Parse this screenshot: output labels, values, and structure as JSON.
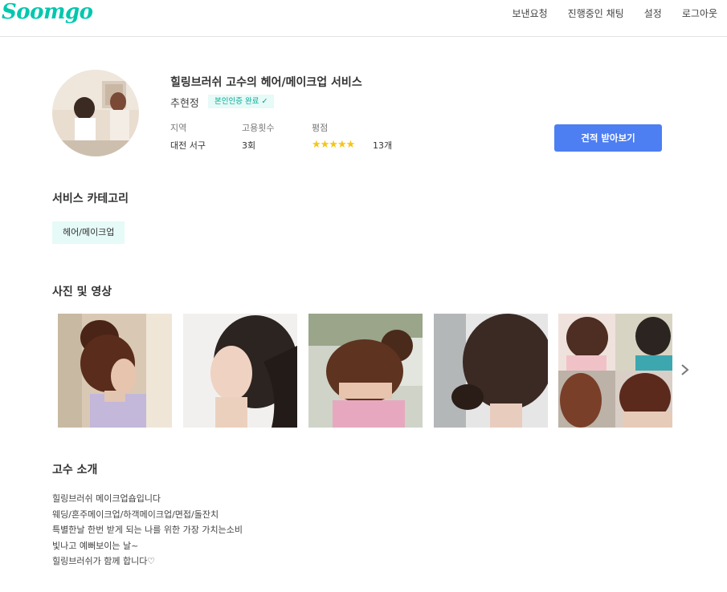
{
  "header": {
    "logo": "Soomgo",
    "nav": [
      "보낸요청",
      "진행중인 채팅",
      "설정",
      "로그아웃"
    ]
  },
  "profile": {
    "title": "힐링브러쉬 고수의 헤어/메이크업 서비스",
    "name": "추현정",
    "verify_badge": "본인인증 완료",
    "stats": {
      "region_label": "지역",
      "region_value": "대전 서구",
      "hires_label": "고용횟수",
      "hires_value": "3회",
      "rating_label": "평점",
      "rating_value": 5,
      "review_count": "13개"
    },
    "quote_button": "견적 받아보기"
  },
  "categories": {
    "title": "서비스 카테고리",
    "items": [
      "헤어/메이크업"
    ]
  },
  "gallery": {
    "title": "사진 및 영상",
    "photo_count_visible": 5
  },
  "intro": {
    "title": "고수 소개",
    "lines": [
      "힐링브러쉬 메이크업숍입니다",
      "웨딩/혼주메이크업/하객메이크업/면접/돌잔치",
      "특별한날 한번 받게 되는 나를 위한 가장 가치는소비",
      "빛나고 예뻐보이는 날~",
      "힐링브러쉬가 함께 합니다♡"
    ]
  },
  "colors": {
    "brand": "#00c7ae",
    "primary_button": "#4d7ef2",
    "badge_bg": "#e6faf7",
    "star": "#f5c518"
  }
}
